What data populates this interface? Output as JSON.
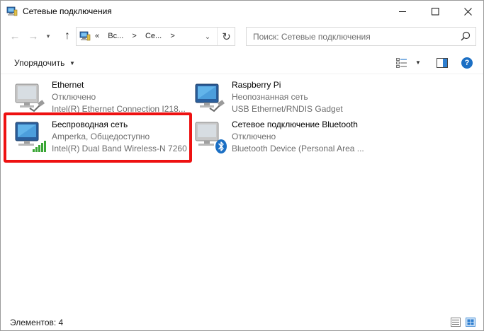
{
  "window": {
    "title": "Сетевые подключения",
    "icon": "network-connections-icon"
  },
  "nav": {
    "address_chevrons": "«",
    "breadcrumb": [
      "Вс...",
      "Се..."
    ],
    "breadcrumb_sep": ">",
    "search_placeholder": "Поиск: Сетевые подключения"
  },
  "command_bar": {
    "organize_label": "Упорядочить"
  },
  "items": [
    {
      "name": "Ethernet",
      "status": "Отключено",
      "device": "Intel(R) Ethernet Connection I218...",
      "icon": "wired-network-icon",
      "signal": false,
      "bluetooth": false
    },
    {
      "name": "Raspberry Pi",
      "status": "Неопознанная сеть",
      "device": "USB Ethernet/RNDIS Gadget",
      "icon": "wired-network-icon",
      "signal": false,
      "bluetooth": false
    },
    {
      "name": "Беспроводная сеть",
      "status": "Amperka, Общедоступно",
      "device": "Intel(R) Dual Band Wireless-N 7260",
      "icon": "wireless-network-icon",
      "signal": true,
      "bluetooth": false
    },
    {
      "name": "Сетевое подключение Bluetooth",
      "status": "Отключено",
      "device": "Bluetooth Device (Personal Area ...",
      "icon": "bluetooth-network-icon",
      "signal": false,
      "bluetooth": true
    }
  ],
  "status_bar": {
    "count_text": "Элементов: 4"
  },
  "colors": {
    "highlight": "#ee1111",
    "accent": "#1b6fc4",
    "signal": "#3aa635"
  }
}
